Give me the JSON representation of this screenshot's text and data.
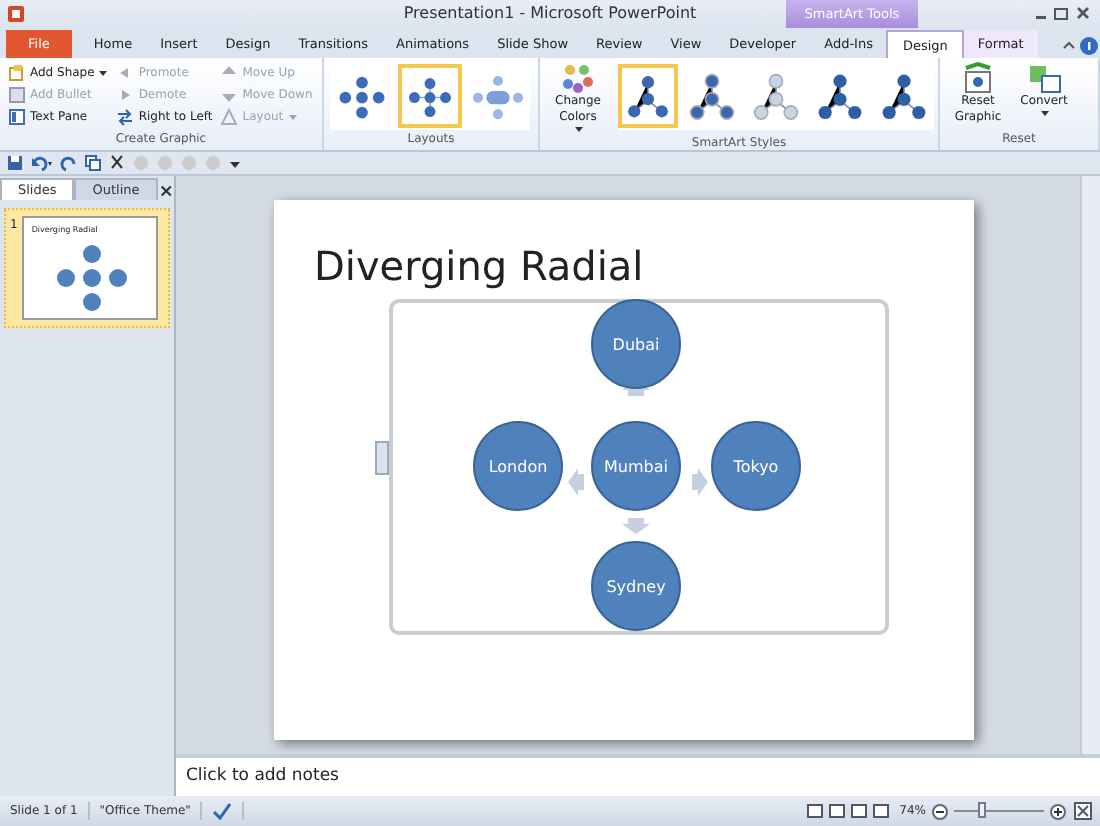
{
  "window": {
    "title": "Presentation1 - Microsoft PowerPoint",
    "context_label": "SmartArt Tools"
  },
  "tabs": [
    {
      "label": "File",
      "kind": "file",
      "selected": false
    },
    {
      "label": "Home",
      "kind": "normal",
      "selected": false
    },
    {
      "label": "Insert",
      "kind": "normal",
      "selected": false
    },
    {
      "label": "Design",
      "kind": "normal",
      "selected": false
    },
    {
      "label": "Transitions",
      "kind": "normal",
      "selected": false
    },
    {
      "label": "Animations",
      "kind": "normal",
      "selected": false
    },
    {
      "label": "Slide Show",
      "kind": "normal",
      "selected": false
    },
    {
      "label": "Review",
      "kind": "normal",
      "selected": false
    },
    {
      "label": "View",
      "kind": "normal",
      "selected": false
    },
    {
      "label": "Developer",
      "kind": "normal",
      "selected": false
    },
    {
      "label": "Add-Ins",
      "kind": "normal",
      "selected": false
    },
    {
      "label": "Design",
      "kind": "context",
      "selected": true
    },
    {
      "label": "Format",
      "kind": "context",
      "selected": false
    }
  ],
  "create_graphic": {
    "label": "Create Graphic",
    "columns": [
      [
        {
          "label": "Add Shape",
          "dropdown": true,
          "disabled": false
        },
        {
          "label": "Add Bullet",
          "dropdown": false,
          "disabled": true
        },
        {
          "label": "Text Pane",
          "dropdown": false,
          "disabled": false
        }
      ],
      [
        {
          "label": "Promote",
          "dropdown": false,
          "disabled": true
        },
        {
          "label": "Demote",
          "dropdown": false,
          "disabled": true
        },
        {
          "label": "Right to Left",
          "dropdown": false,
          "disabled": false
        }
      ],
      [
        {
          "label": "Move Up",
          "dropdown": false,
          "disabled": true
        },
        {
          "label": "Move Down",
          "dropdown": false,
          "disabled": true
        },
        {
          "label": "Layout",
          "dropdown": true,
          "disabled": true
        }
      ]
    ]
  },
  "layouts": {
    "label": "Layouts",
    "items": [
      {
        "selected": false
      },
      {
        "selected": true
      },
      {
        "selected": false
      }
    ]
  },
  "smartart_styles": {
    "label": "SmartArt Styles",
    "change_colors": "Change Colors",
    "items": [
      {
        "selected": true
      },
      {
        "selected": false
      },
      {
        "selected": false
      },
      {
        "selected": false
      },
      {
        "selected": false
      }
    ]
  },
  "reset": {
    "label": "Reset",
    "buttons": [
      {
        "label": "Reset Graphic",
        "dropdown": false
      },
      {
        "label": "Convert",
        "dropdown": true
      }
    ]
  },
  "pane_tabs": [
    {
      "label": "Slides",
      "selected": true
    },
    {
      "label": "Outline",
      "selected": false
    }
  ],
  "thumbnail": {
    "number": "1",
    "title": "Diverging Radial",
    "selected": true
  },
  "slide": {
    "title": "Diverging Radial",
    "nodes": [
      {
        "label": "Dubai"
      },
      {
        "label": "London"
      },
      {
        "label": "Mumbai"
      },
      {
        "label": "Tokyo"
      },
      {
        "label": "Sydney"
      }
    ]
  },
  "notes": {
    "placeholder": "Click to add notes"
  },
  "status_bar": {
    "slide": "Slide 1 of 1",
    "theme": "\"Office Theme\"",
    "zoom": "74%",
    "zoom_slider": {
      "level": 0.3
    }
  }
}
